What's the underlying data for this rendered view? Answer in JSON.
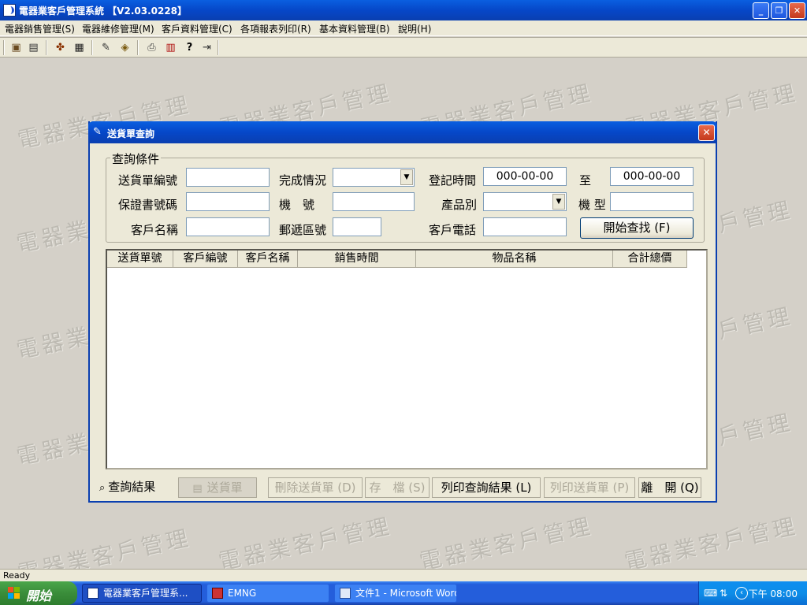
{
  "window": {
    "title": "電器業客戶管理系統 【V2.03.0228】",
    "minimize": "_",
    "maximize": "❐",
    "close": "✕"
  },
  "menu": [
    {
      "label": "電器銷售管理(S)"
    },
    {
      "label": "電器維修管理(M)"
    },
    {
      "label": "客戶資料管理(C)"
    },
    {
      "label": "各項報表列印(R)"
    },
    {
      "label": "基本資料管理(B)"
    },
    {
      "label": "說明(H)"
    }
  ],
  "toolbar_icons": [
    "contacts-icon",
    "document-icon",
    "tools-icon",
    "calendar-icon",
    "edit-icon",
    "book-icon",
    "print-icon",
    "chart-icon",
    "help-icon",
    "exit-icon"
  ],
  "watermark": "電器業客戶管理",
  "watermark_partial": "電器業",
  "watermark_partial_right": "戶管理",
  "dialog": {
    "title": "送貨單查詢",
    "close": "✕",
    "group_title": "查詢條件",
    "fields": {
      "delivery_no_label": "送貨單編號",
      "status_label": "完成情況",
      "reg_time_label": "登記時間",
      "reg_time_from": "000-00-00",
      "to_label": "至",
      "reg_time_to": "000-00-00",
      "warranty_label": "保證書號碼",
      "machine_no_label": "機　號",
      "product_cat_label": "產品別",
      "model_label": "機 型",
      "customer_name_label": "客戶名稱",
      "zip_label": "郵遞區號",
      "phone_label": "客戶電話"
    },
    "search_button": "開始查找 (F)",
    "columns": [
      "送貨單號",
      "客戶編號",
      "客戶名稱",
      "銷售時間",
      "物品名稱",
      "合計總價"
    ],
    "tabs": {
      "results": "查詢結果",
      "delivery": "送貨單"
    },
    "buttons": {
      "delete": "刪除送貨單 (D)",
      "save": "存　檔 (S)",
      "print_results": "列印查詢結果 (L)",
      "print_delivery": "列印送貨單 (P)",
      "exit": "離　開 (Q)"
    }
  },
  "status_bar": "Ready",
  "taskbar": {
    "start": "開始",
    "tasks": [
      "電器業客戶管理系...",
      "EMNG",
      "文件1 - Microsoft Word"
    ],
    "clock": "下午 08:00"
  }
}
